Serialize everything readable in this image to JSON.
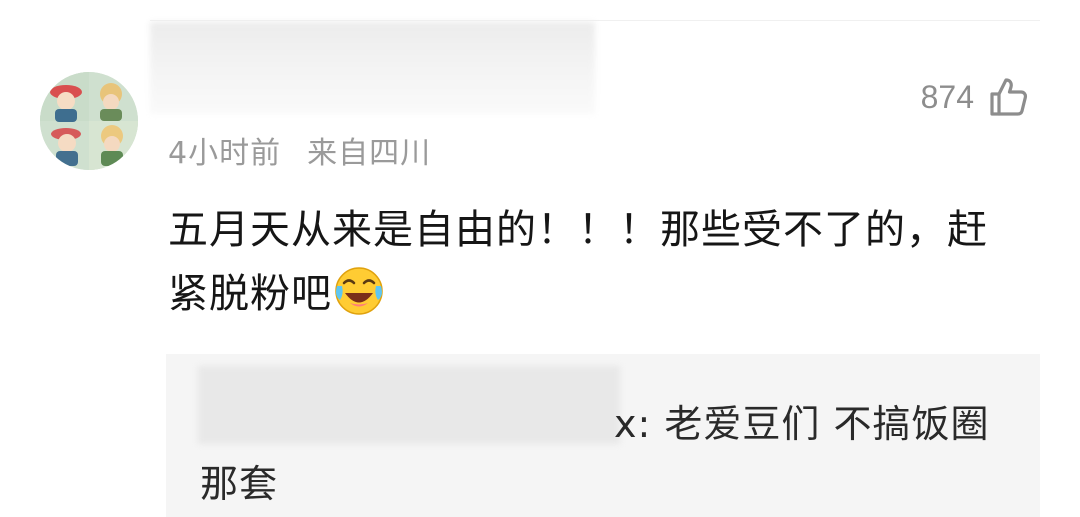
{
  "comment": {
    "meta": {
      "time": "4小时前",
      "location": "来自四川"
    },
    "likes": {
      "count": "874",
      "icon": "thumbs-up-icon"
    },
    "text": "五月天从来是自由的！！！那些受不了的，赶紧脱粉吧",
    "emoji": "laughing-crying-emoji",
    "reply": {
      "text": "x: 老爱豆们 不搞饭圈那套"
    }
  }
}
